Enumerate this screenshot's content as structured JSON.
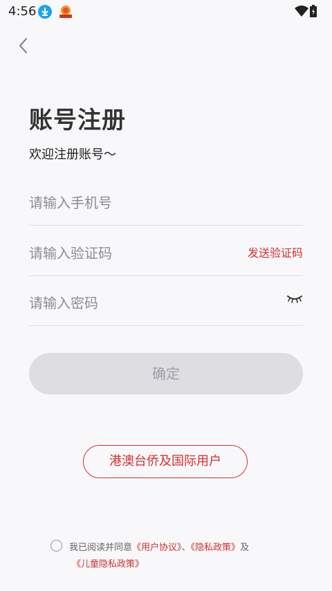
{
  "status_bar": {
    "time": "4:56",
    "icons": [
      "download-icon",
      "app-notification-icon",
      "wifi-icon",
      "battery-icon"
    ]
  },
  "header": {
    "back_icon": "chevron-left-icon"
  },
  "page": {
    "title": "账号注册",
    "subtitle": "欢迎注册账号～"
  },
  "form": {
    "phone_placeholder": "请输入手机号",
    "code_placeholder": "请输入验证码",
    "send_code_label": "发送验证码",
    "password_placeholder": "请输入密码",
    "password_toggle_icon": "eye-closed-icon",
    "confirm_label": "确定"
  },
  "intl_button_label": "港澳台侨及国际用户",
  "agreement": {
    "prefix": "我已阅读并同意",
    "user_agreement": "《用户协议》",
    "separator": "、",
    "privacy_policy": "《隐私政策》",
    "and": "及",
    "children_privacy": "《儿童隐私政策》"
  },
  "colors": {
    "accent": "#d32f2f",
    "background": "#f8f8fa",
    "button_disabled": "#dddde2"
  }
}
